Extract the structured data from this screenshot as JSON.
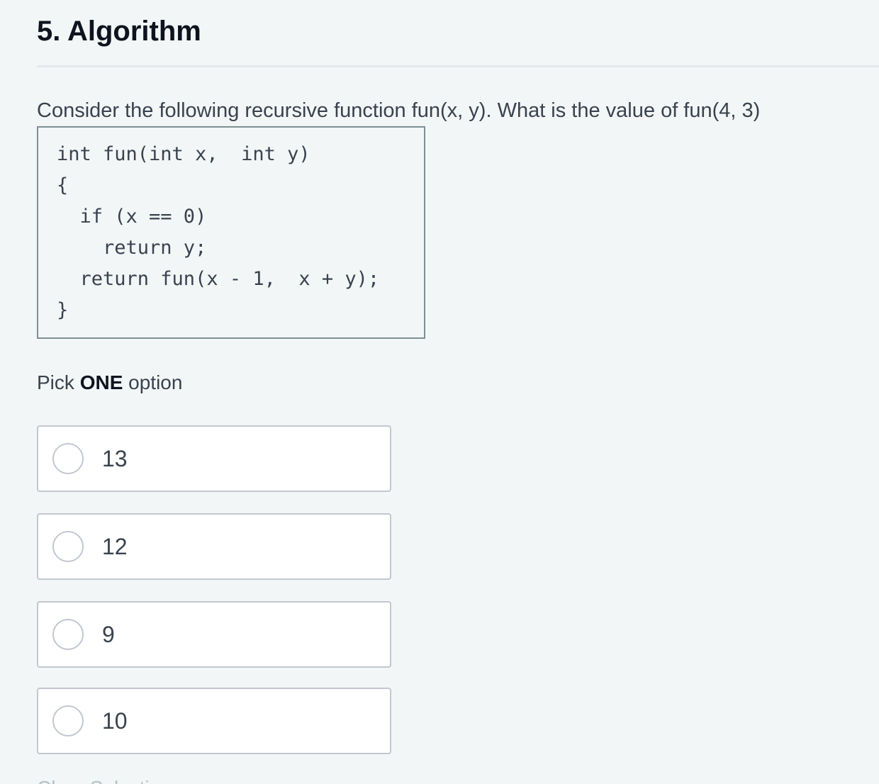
{
  "header": {
    "title": "5. Algorithm"
  },
  "question": {
    "text": "Consider the following recursive function fun(x, y). What is the value of fun(4, 3)"
  },
  "code": {
    "lines": [
      "int fun(int x,  int y)",
      "{",
      "  if (x == 0)",
      "    return y;",
      "  return fun(x - 1,  x + y);",
      "}"
    ]
  },
  "pick": {
    "prefix": "Pick ",
    "emphasis": "ONE",
    "suffix": " option"
  },
  "options": [
    {
      "label": "13",
      "selected": false
    },
    {
      "label": "12",
      "selected": false
    },
    {
      "label": "9",
      "selected": false
    },
    {
      "label": "10",
      "selected": false
    }
  ],
  "footer": {
    "clear_selection_label": "Clear Selection"
  }
}
